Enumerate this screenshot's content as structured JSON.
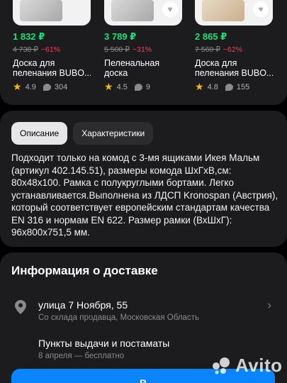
{
  "products": [
    {
      "price": "1 832 ₽",
      "old_price": "4 738 ₽",
      "discount": "−61%",
      "title": "Доска для пеленания BUBO...",
      "rating": "4.9",
      "reviews": "304"
    },
    {
      "price": "3 789 ₽",
      "old_price": "5 500 ₽",
      "discount": "−31%",
      "title": "Пеленальная доска",
      "rating": "4.5",
      "reviews": "9"
    },
    {
      "price": "2 865 ₽",
      "old_price": "7 560 ₽",
      "discount": "−62%",
      "title": "Доска для пеленания BUBO...",
      "rating": "4.8",
      "reviews": "155"
    }
  ],
  "tabs": {
    "description": "Описание",
    "specs": "Характеристики"
  },
  "description": "Подходит только на комод с 3-мя ящиками Икея Мальм (артикул 402.145.51), размеры комода ШхГхВ,см: 80x48x100. Рамка с полукруглыми бортами. Легко устанавливается.Выполнена из ЛДСП Kronospan (Австрия), который соответствует европейским стандартам качества EN 316 и нормам EN 622. Размер рамки (ВхШхГ): 96х800х751,5 мм.",
  "delivery": {
    "heading": "Информация о доставке",
    "address": "улица 7 Ноября, 55",
    "address_sub": "Со склада продавца, Московская Область",
    "pickup": "Пункты выдачи и постаматы",
    "pickup_sub": "8 апреля — бесплатно",
    "button_label": "В"
  },
  "watermark": "Avito",
  "colors": {
    "price": "#1ee07a",
    "discount": "#ff3b57",
    "star": "#ffb800",
    "accent": "#0a84ff",
    "panel": "#1c1c1e"
  }
}
